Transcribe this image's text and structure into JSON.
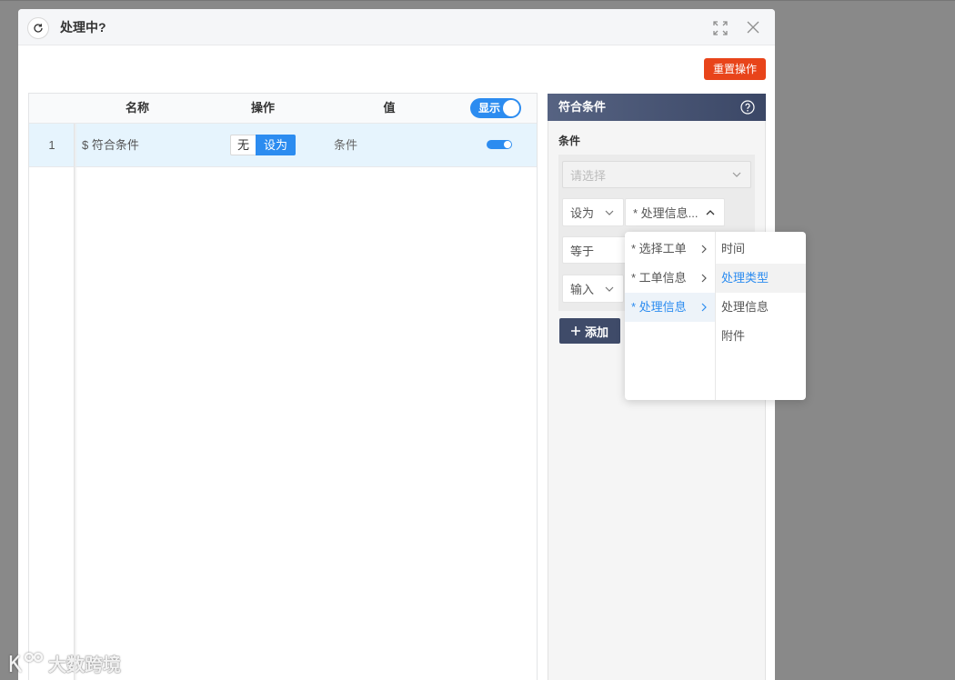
{
  "colors": {
    "overlay": "#898989",
    "accent": "#2c8cf0",
    "danger": "#e8441a",
    "panel_header_start": "#566382",
    "panel_header_end": "#3b4766",
    "add_button": "#3f4b69",
    "row_selected": "#e6f4fd"
  },
  "dialog": {
    "title": "处理中?",
    "refresh_icon": "refresh-icon",
    "expand_icon": "expand-icon",
    "close_icon": "close-icon",
    "reset_button": "重置操作"
  },
  "table": {
    "columns": {
      "name": "名称",
      "operation": "操作",
      "value": "值"
    },
    "display_toggle": {
      "label": "显示",
      "on": true
    },
    "rows": [
      {
        "index": "1",
        "name": "$ 符合条件",
        "selected": true,
        "operation_options": [
          {
            "label": "无",
            "selected": false
          },
          {
            "label": "设为",
            "selected": true
          }
        ],
        "value": "条件",
        "enabled": true
      }
    ]
  },
  "panel": {
    "title": "符合条件",
    "help_icon": "question-circle-icon",
    "section_label": "条件",
    "source_select": {
      "placeholder": "请选择",
      "disabled": true
    },
    "rule": {
      "action": "设为",
      "field": "* 处理信息...",
      "field_open": true,
      "operator": "等于",
      "value_mode": "输入"
    },
    "add_button": "添加"
  },
  "cascader": {
    "level1": [
      {
        "label": "* 选择工单",
        "active": false
      },
      {
        "label": "* 工单信息",
        "active": false
      },
      {
        "label": "* 处理信息",
        "active": true
      }
    ],
    "level2": [
      {
        "label": "时间",
        "hover": false
      },
      {
        "label": "处理类型",
        "hover": true
      },
      {
        "label": "处理信息",
        "hover": false
      },
      {
        "label": "附件",
        "hover": false
      }
    ]
  },
  "watermark": {
    "text": "大数跨境"
  }
}
